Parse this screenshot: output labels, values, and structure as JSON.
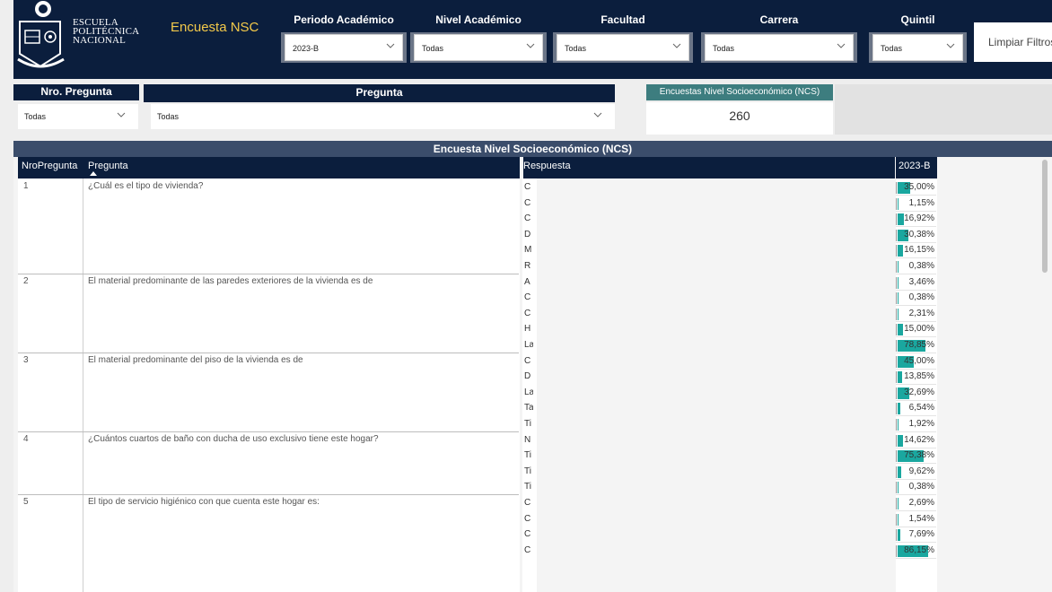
{
  "header": {
    "logo_lines": [
      "ESCUELA",
      "POLITÉCNICA",
      "NACIONAL"
    ],
    "title": "Encuesta NSC",
    "filters": [
      {
        "label": "Periodo Académico",
        "value": "2023-B"
      },
      {
        "label": "Nivel Académico",
        "value": "Todas"
      },
      {
        "label": "Facultad",
        "value": "Todas"
      },
      {
        "label": "Carrera",
        "value": "Todas"
      },
      {
        "label": "Quintil",
        "value": "Todas"
      }
    ],
    "clear_button": "Limpiar Filtros"
  },
  "subfilters": {
    "nro_label": "Nro. Pregunta",
    "nro_value": "Todas",
    "pregunta_label": "Pregunta",
    "pregunta_value": "Todas"
  },
  "card": {
    "title": "Encuestas Nivel Socioeconómico (NCS)",
    "value": "260"
  },
  "table": {
    "title": "Encuesta Nivel Socioeconómico (NCS)",
    "headers": {
      "nro": "NroPregunta",
      "pregunta": "Pregunta",
      "respuesta": "Respuesta",
      "period": "2023-B"
    },
    "groups": [
      {
        "nro": "1",
        "pregunta": "¿Cuál es el tipo de vivienda?",
        "rows": [
          {
            "resp": "C",
            "value": "35,00%",
            "pct": 35.0
          },
          {
            "resp": "C",
            "value": "1,15%",
            "pct": 1.15
          },
          {
            "resp": "C",
            "value": "16,92%",
            "pct": 16.92
          },
          {
            "resp": "D",
            "value": "30,38%",
            "pct": 30.38
          },
          {
            "resp": "M",
            "value": "16,15%",
            "pct": 16.15
          },
          {
            "resp": "R",
            "value": "0,38%",
            "pct": 0.38
          }
        ]
      },
      {
        "nro": "2",
        "pregunta": "El material predominante de las paredes exteriores de la vivienda es de",
        "rows": [
          {
            "resp": "A",
            "value": "3,46%",
            "pct": 3.46
          },
          {
            "resp": "C",
            "value": "0,38%",
            "pct": 0.38
          },
          {
            "resp": "C",
            "value": "2,31%",
            "pct": 2.31
          },
          {
            "resp": "H",
            "value": "15,00%",
            "pct": 15.0
          },
          {
            "resp": "La",
            "value": "78,85%",
            "pct": 78.85
          }
        ]
      },
      {
        "nro": "3",
        "pregunta": "El material predominante del piso de la vivienda es de",
        "rows": [
          {
            "resp": "C",
            "value": "45,00%",
            "pct": 45.0
          },
          {
            "resp": "D",
            "value": "13,85%",
            "pct": 13.85
          },
          {
            "resp": "La",
            "value": "32,69%",
            "pct": 32.69
          },
          {
            "resp": "Ta",
            "value": "6,54%",
            "pct": 6.54
          },
          {
            "resp": "Ti",
            "value": "1,92%",
            "pct": 1.92
          }
        ]
      },
      {
        "nro": "4",
        "pregunta": "¿Cuántos cuartos de baño con ducha de uso exclusivo tiene este hogar?",
        "rows": [
          {
            "resp": "N",
            "value": "14,62%",
            "pct": 14.62
          },
          {
            "resp": "Ti",
            "value": "75,38%",
            "pct": 75.38
          },
          {
            "resp": "Ti",
            "value": "9,62%",
            "pct": 9.62
          },
          {
            "resp": "Ti",
            "value": "0,38%",
            "pct": 0.38
          }
        ]
      },
      {
        "nro": "5",
        "pregunta": "El tipo de servicio higiénico con que cuenta este hogar es:",
        "rows": [
          {
            "resp": "C",
            "value": "2,69%",
            "pct": 2.69
          },
          {
            "resp": "C",
            "value": "1,54%",
            "pct": 1.54
          },
          {
            "resp": "C",
            "value": "7,69%",
            "pct": 7.69
          },
          {
            "resp": "C",
            "value": "86,15%",
            "pct": 86.15
          }
        ]
      }
    ]
  },
  "colors": {
    "navy": "#0b1e3d",
    "teal_bar": "#1aa79f",
    "title_yellow": "#f3c94a",
    "card_teal": "#3d7d7f"
  }
}
